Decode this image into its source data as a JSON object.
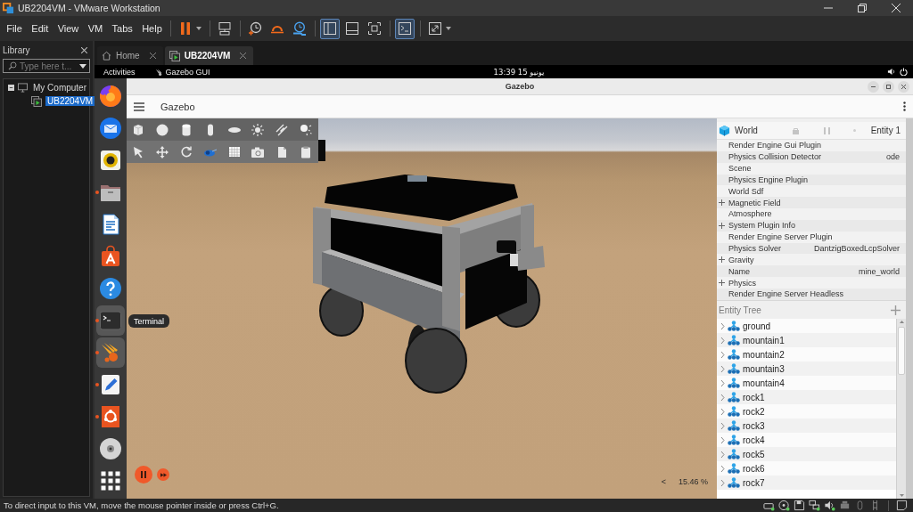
{
  "window": {
    "title": "UB2204VM - VMware Workstation"
  },
  "menu": [
    "File",
    "Edit",
    "View",
    "VM",
    "Tabs",
    "Help"
  ],
  "toolbar": [
    {
      "items": [
        {
          "kind": "pause",
          "selected": false,
          "dropdown": true
        }
      ]
    },
    {
      "items": [
        {
          "kind": "send-keys",
          "selected": false,
          "dropdown": false
        }
      ]
    },
    {
      "items": [
        {
          "kind": "snapshot",
          "selected": false,
          "dropdown": false
        },
        {
          "kind": "revert",
          "selected": false,
          "dropdown": false
        },
        {
          "kind": "manage-snapshots",
          "selected": false,
          "dropdown": false
        }
      ]
    },
    {
      "items": [
        {
          "kind": "library-view",
          "selected": true,
          "dropdown": false
        },
        {
          "kind": "thumbnail-bar",
          "selected": false,
          "dropdown": false
        },
        {
          "kind": "full-screen",
          "selected": false,
          "dropdown": false
        }
      ]
    },
    {
      "items": [
        {
          "kind": "console",
          "selected": true,
          "dropdown": false
        }
      ]
    },
    {
      "items": [
        {
          "kind": "stretch",
          "selected": false,
          "dropdown": true
        }
      ]
    }
  ],
  "library": {
    "title": "Library",
    "search": {
      "placeholder": "Type here t..."
    },
    "tree": [
      {
        "label": "My Computer",
        "expanded": true,
        "selected": false,
        "children": [
          {
            "label": "UB2204VM",
            "selected": true
          }
        ]
      }
    ]
  },
  "tabs": [
    {
      "label": "Home",
      "kind": "home",
      "selected": false
    },
    {
      "label": "UB2204VM",
      "kind": "vm",
      "selected": true
    }
  ],
  "guest": {
    "top_bar": {
      "activities": "Activities",
      "app": "Gazebo GUI",
      "clock": "13:39 15 يونيو"
    },
    "dock": [
      {
        "kind": "browser",
        "running": false,
        "highlighted": false
      },
      {
        "kind": "mail",
        "running": false,
        "highlighted": false
      },
      {
        "kind": "music",
        "running": false,
        "highlighted": false
      },
      {
        "kind": "files",
        "running": true,
        "highlighted": false
      },
      {
        "kind": "writer",
        "running": false,
        "highlighted": false
      },
      {
        "kind": "store",
        "running": false,
        "highlighted": false
      },
      {
        "kind": "help",
        "running": false,
        "highlighted": false
      },
      {
        "kind": "terminal",
        "running": true,
        "highlighted": true,
        "tooltip": "Terminal"
      },
      {
        "kind": "simulator",
        "running": true,
        "highlighted": true
      },
      {
        "kind": "editor",
        "running": true,
        "highlighted": false
      },
      {
        "kind": "ubuntu",
        "running": true,
        "highlighted": false
      },
      {
        "kind": "disc",
        "running": false,
        "highlighted": false
      },
      {
        "kind": "apps",
        "running": false,
        "highlighted": false
      }
    ],
    "gazebo": {
      "title": "Gazebo",
      "app_title": "Gazebo",
      "simulation": {
        "running": true,
        "rtf_toggle": "<",
        "rtf": "15.46 %"
      },
      "world": {
        "title": "World",
        "entity": "Entity 1",
        "properties": [
          {
            "label": "Render Engine Gui Plugin",
            "expandable": false
          },
          {
            "label": "Physics Collision Detector",
            "value": "ode",
            "expandable": false
          },
          {
            "label": "Scene",
            "expandable": false
          },
          {
            "label": "Physics Engine Plugin",
            "expandable": false
          },
          {
            "label": "World Sdf",
            "expandable": false
          },
          {
            "label": "Magnetic Field",
            "expandable": true
          },
          {
            "label": "Atmosphere",
            "expandable": false
          },
          {
            "label": "System Plugin Info",
            "expandable": true
          },
          {
            "label": "Render Engine Server Plugin",
            "expandable": false
          },
          {
            "label": "Physics Solver",
            "value": "DantzigBoxedLcpSolver",
            "expandable": false
          },
          {
            "label": "Gravity",
            "expandable": true
          },
          {
            "label": "Name",
            "value": "mine_world",
            "expandable": false
          },
          {
            "label": "Physics",
            "expandable": true
          },
          {
            "label": "Render Engine Server Headless",
            "expandable": false
          }
        ]
      },
      "entity_tree": {
        "title": "Entity Tree",
        "items": [
          {
            "label": "ground",
            "expanded": false
          },
          {
            "label": "mountain1",
            "expanded": false
          },
          {
            "label": "mountain2",
            "expanded": false
          },
          {
            "label": "mountain3",
            "expanded": false
          },
          {
            "label": "mountain4",
            "expanded": false
          },
          {
            "label": "rock1",
            "expanded": false
          },
          {
            "label": "rock2",
            "expanded": false
          },
          {
            "label": "rock3",
            "expanded": false
          },
          {
            "label": "rock4",
            "expanded": false
          },
          {
            "label": "rock5",
            "expanded": false
          },
          {
            "label": "rock6",
            "expanded": false
          },
          {
            "label": "rock7",
            "expanded": false
          }
        ]
      }
    }
  },
  "status_bar": {
    "text": "To direct input to this VM, move the mouse pointer inside or press Ctrl+G."
  }
}
